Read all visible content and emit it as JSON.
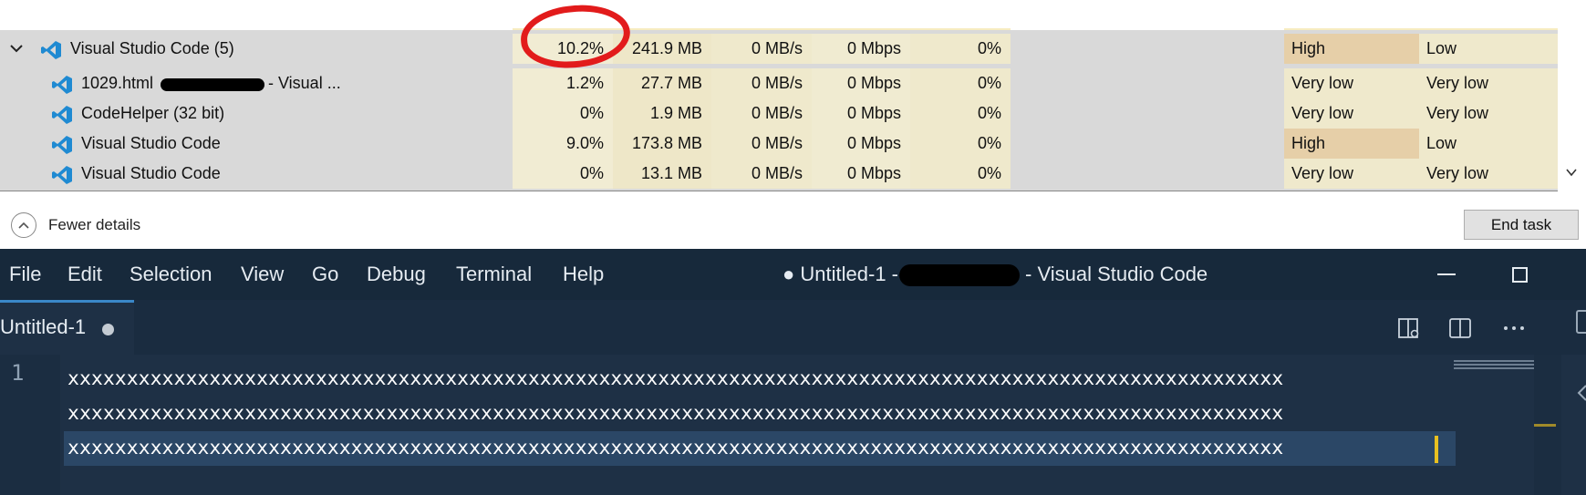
{
  "task_manager": {
    "rows": [
      {
        "name": "Visual Studio Code (5)",
        "cpu": "10.2%",
        "memory": "241.9 MB",
        "disk": "0 MB/s",
        "network": "0 Mbps",
        "gpu": "0%",
        "power": "High",
        "power_trend": "Low"
      },
      {
        "name": "1029.html",
        "name_suffix": "- Visual ...",
        "cpu": "1.2%",
        "memory": "27.7 MB",
        "disk": "0 MB/s",
        "network": "0 Mbps",
        "gpu": "0%",
        "power": "Very low",
        "power_trend": "Very low"
      },
      {
        "name": "CodeHelper (32 bit)",
        "cpu": "0%",
        "memory": "1.9 MB",
        "disk": "0 MB/s",
        "network": "0 Mbps",
        "gpu": "0%",
        "power": "Very low",
        "power_trend": "Very low"
      },
      {
        "name": "Visual Studio Code",
        "cpu": "9.0%",
        "memory": "173.8 MB",
        "disk": "0 MB/s",
        "network": "0 Mbps",
        "gpu": "0%",
        "power": "High",
        "power_trend": "Low"
      },
      {
        "name": "Visual Studio Code",
        "cpu": "0%",
        "memory": "13.1 MB",
        "disk": "0 MB/s",
        "network": "0 Mbps",
        "gpu": "0%",
        "power": "Very low",
        "power_trend": "Very low"
      }
    ],
    "fewer_details_label": "Fewer details",
    "end_task_label": "End task",
    "icons": {
      "expand": "chevron-down-icon",
      "vscode": "vscode-icon",
      "collapse": "chevron-up-icon",
      "scroll": "scroll-down-icon"
    }
  },
  "vscode": {
    "menu": [
      "File",
      "Edit",
      "Selection",
      "View",
      "Go",
      "Debug",
      "Terminal",
      "Help"
    ],
    "title_prefix": "● Untitled-1 -",
    "title_suffix": "- Visual Studio Code",
    "tab_label": "Untitled-1",
    "editor": {
      "line_number": "1",
      "lines": [
        "xxxxxxxxxxxxxxxxxxxxxxxxxxxxxxxxxxxxxxxxxxxxxxxxxxxxxxxxxxxxxxxxxxxxxxxxxxxxxxxxxxxxxxxxxxxxxxxxxxxxxxx",
        "xxxxxxxxxxxxxxxxxxxxxxxxxxxxxxxxxxxxxxxxxxxxxxxxxxxxxxxxxxxxxxxxxxxxxxxxxxxxxxxxxxxxxxxxxxxxxxxxxxxxxxx",
        "xxxxxxxxxxxxxxxxxxxxxxxxxxxxxxxxxxxxxxxxxxxxxxxxxxxxxxxxxxxxxxxxxxxxxxxxxxxxxxxxxxxxxxxxxxxxxxxxxxxxxxx"
      ]
    },
    "colors": {
      "titlebar": "#17293b",
      "editor_bg": "#1e3045",
      "selection": "#2b4766",
      "cursor": "#e8c020",
      "tab_accent": "#3a87c8"
    },
    "icons": {
      "open_preview": "open-preview-icon",
      "split_editor": "split-editor-icon",
      "more": "more-actions-icon",
      "minimize": "minimize-icon",
      "maximize": "maximize-icon"
    }
  },
  "annotation": {
    "color": "#e21b1b",
    "target": "cpu-value"
  }
}
